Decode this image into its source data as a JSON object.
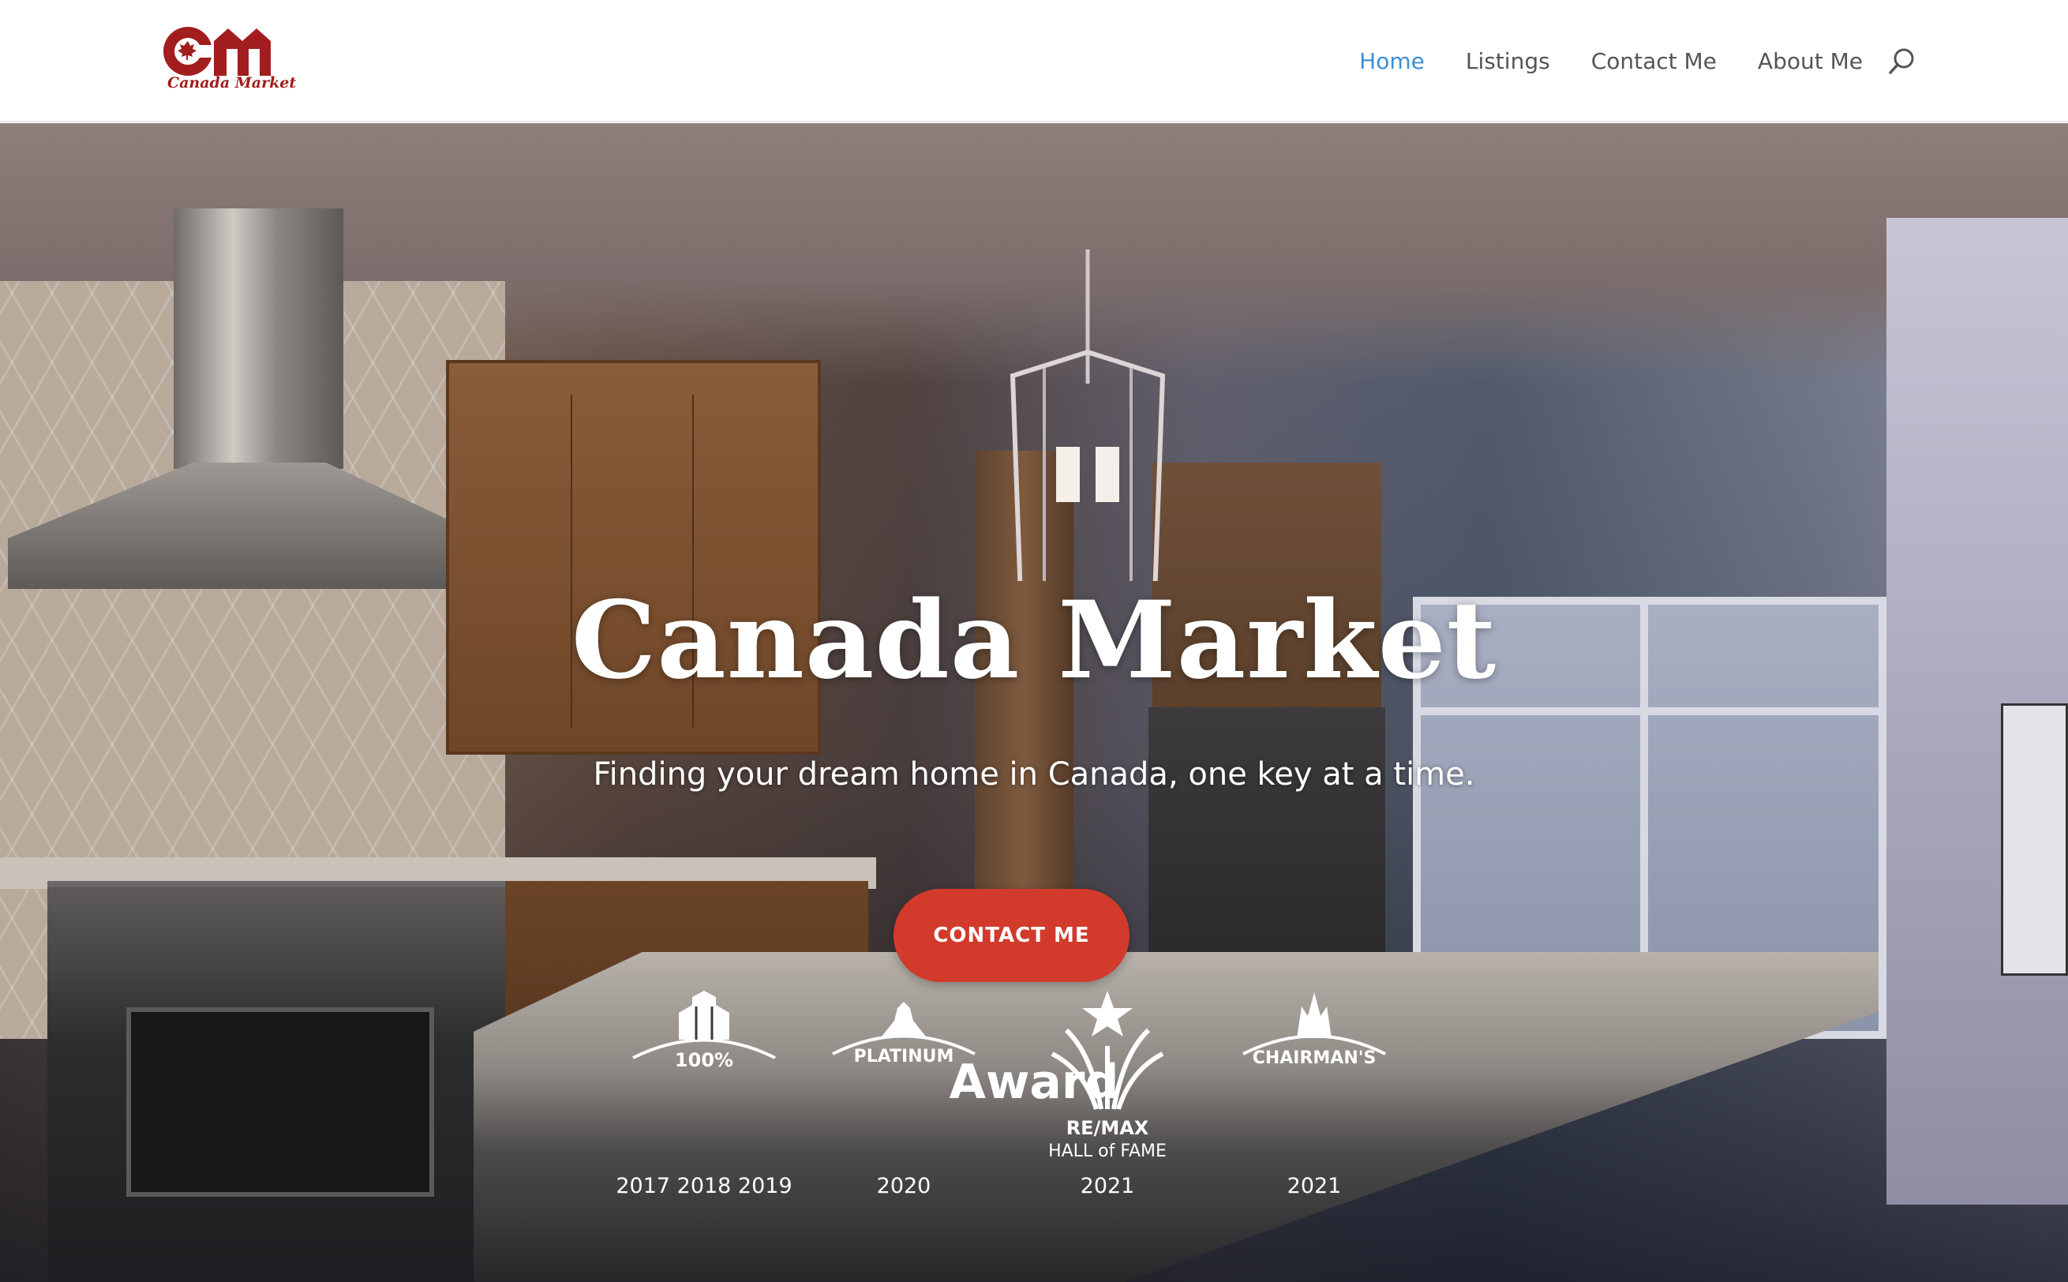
{
  "header": {
    "logo": {
      "monogram": "CM",
      "text": "Canada Market",
      "brand_color": "#a21d1d"
    },
    "nav": [
      {
        "label": "Home",
        "active": true
      },
      {
        "label": "Listings",
        "active": false
      },
      {
        "label": "Contact Me",
        "active": false
      },
      {
        "label": "About Me",
        "active": false
      }
    ],
    "search_icon": "search-icon",
    "active_color": "#3b8fd6"
  },
  "hero": {
    "title": "Canada Market",
    "subtitle": "Finding your dream home in Canada, one key at a time.",
    "cta_label": "CONTACT ME",
    "cta_color": "#d23a2b"
  },
  "awards": {
    "heading": "Award",
    "items": [
      {
        "badge": "100%",
        "years": "2017 2018 2019",
        "icon": "remax-100-percent-club-icon"
      },
      {
        "badge": "PLATINUM",
        "years": "2020",
        "icon": "remax-platinum-club-icon"
      },
      {
        "badge_line1": "RE/MAX",
        "badge_line2": "HALL of FAME",
        "years": "2021",
        "icon": "remax-hall-of-fame-icon"
      },
      {
        "badge": "CHAIRMAN'S",
        "years": "2021",
        "icon": "remax-chairmans-club-icon"
      }
    ]
  }
}
